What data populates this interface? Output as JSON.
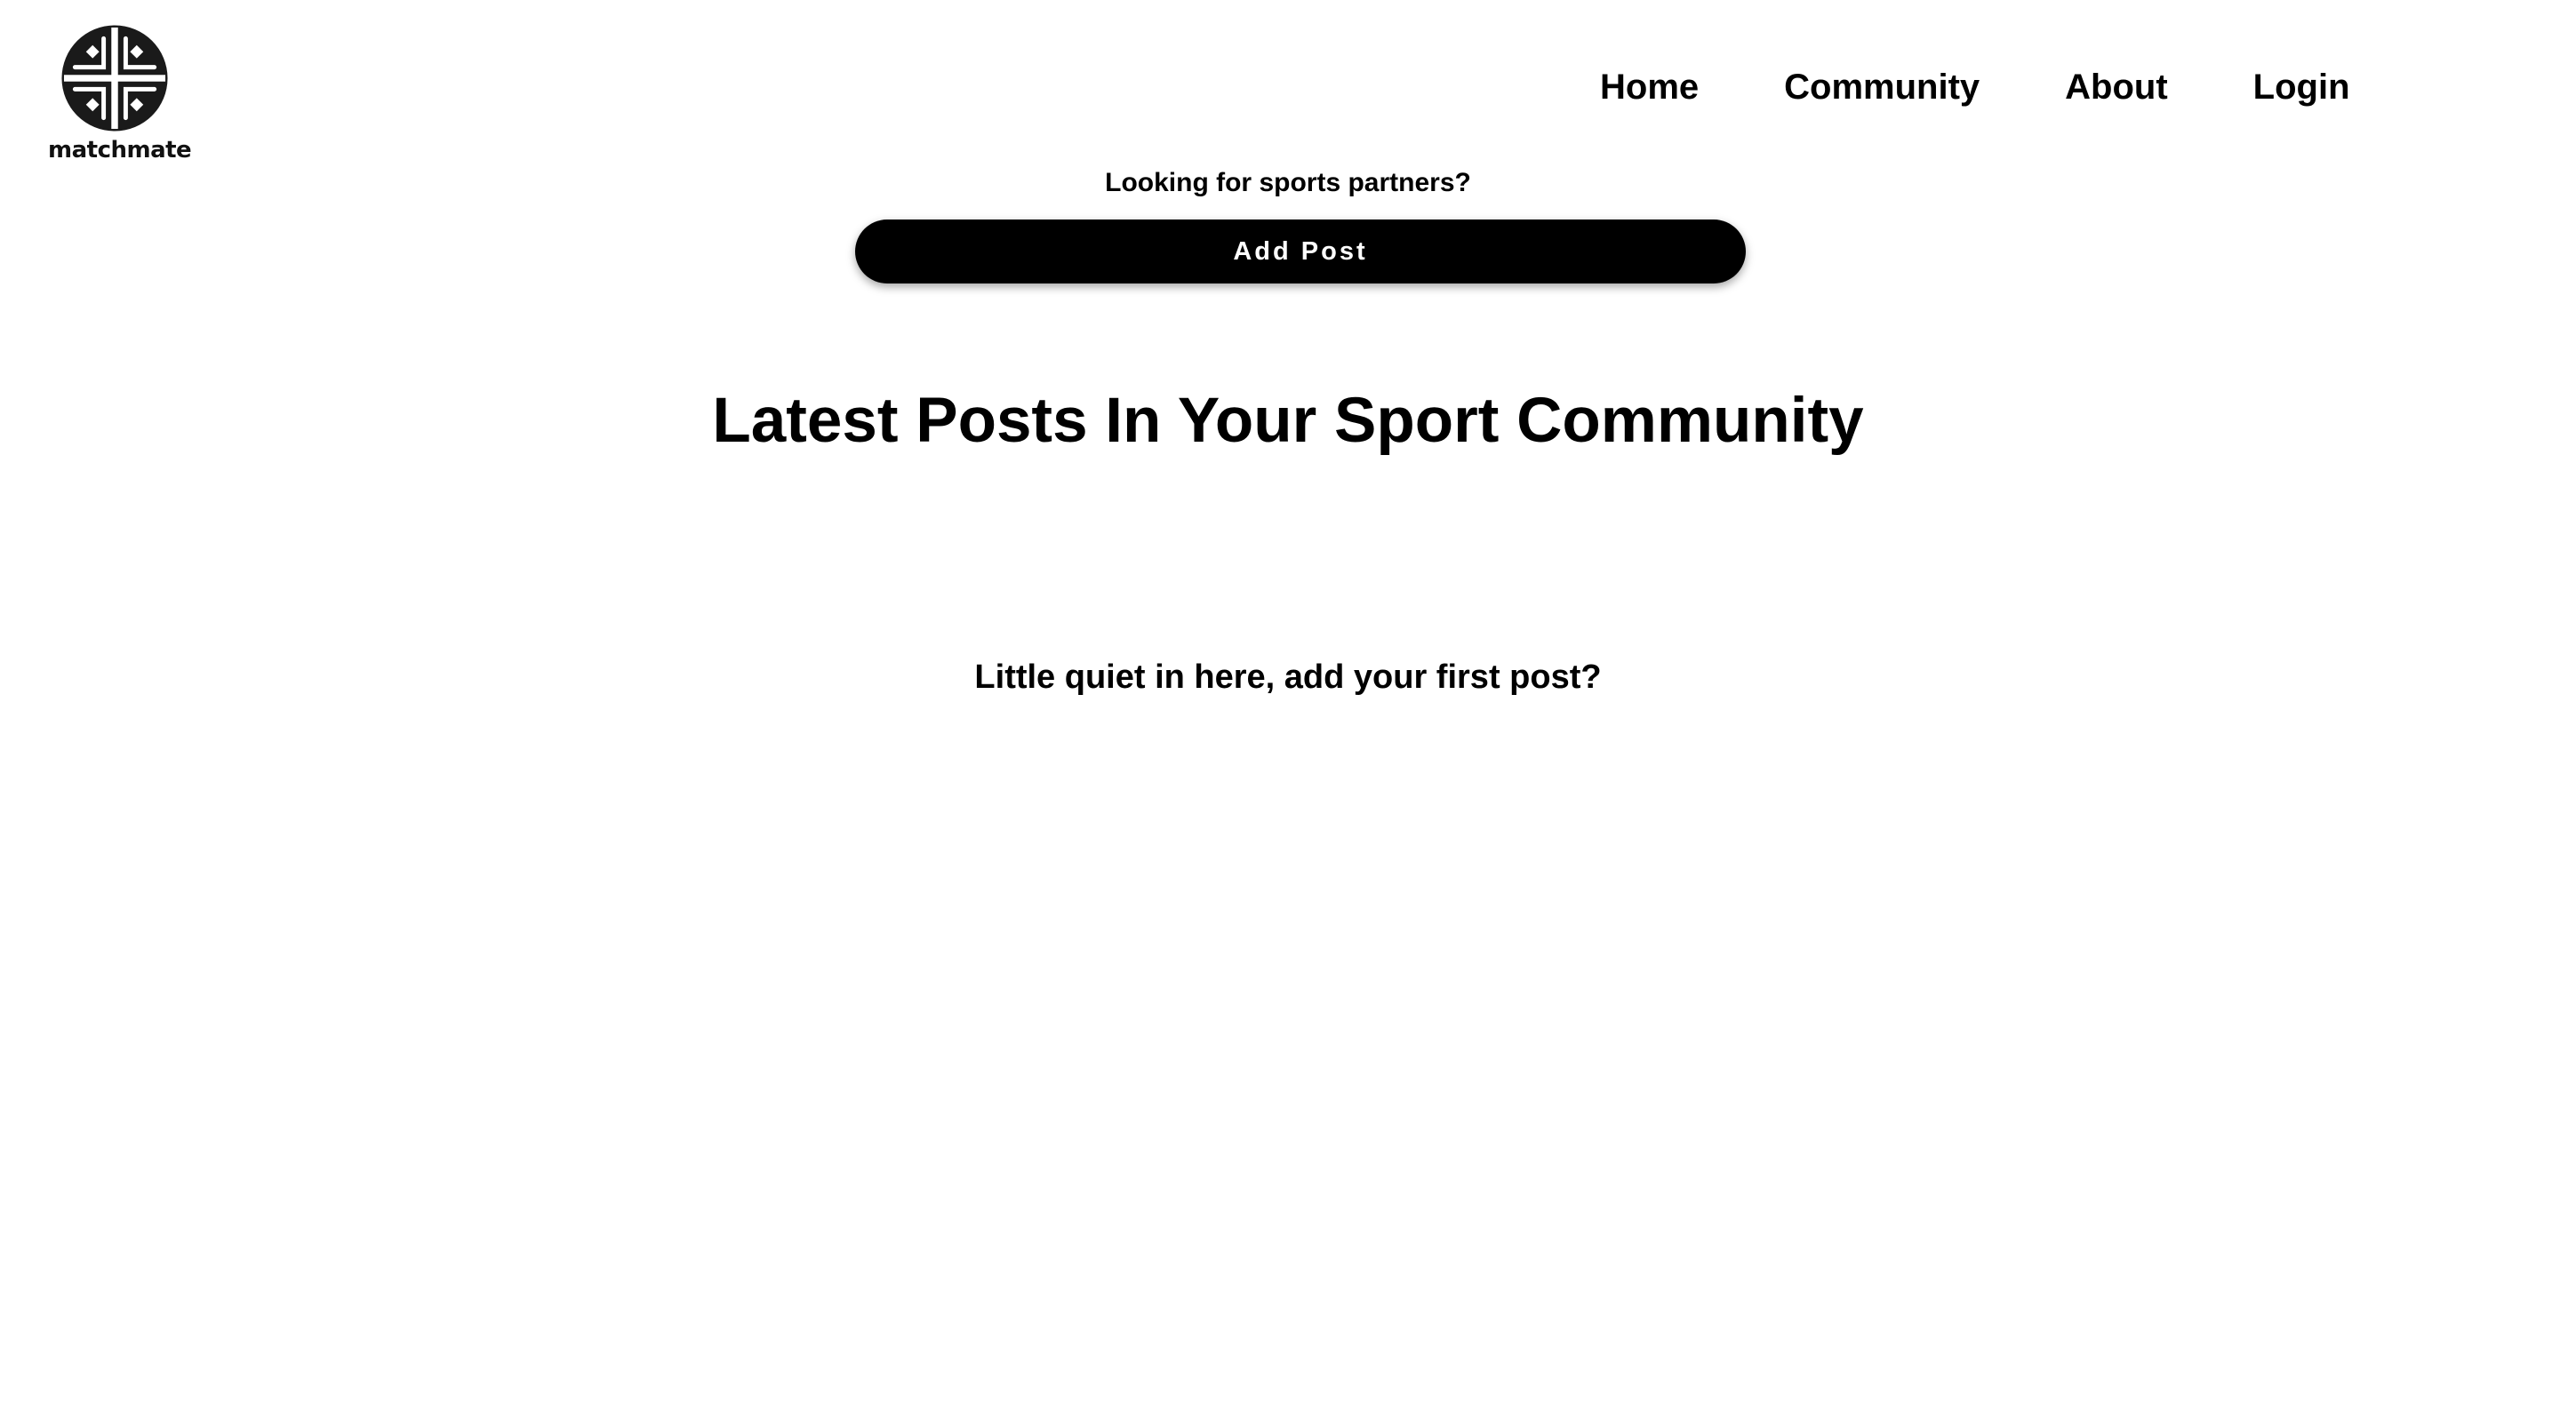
{
  "brand": {
    "name": "matchmate",
    "logo_icon": "sport-ball-emblem-icon",
    "color": "#1a1a1a"
  },
  "nav": {
    "items": [
      {
        "label": "Home"
      },
      {
        "label": "Community"
      },
      {
        "label": "About"
      },
      {
        "label": "Login"
      }
    ]
  },
  "main": {
    "prompt": "Looking for sports partners?",
    "add_post_label": "Add Post",
    "heading": "Latest Posts In Your Sport Community",
    "empty_message": "Little quiet in here, add your first post?"
  },
  "colors": {
    "background": "#ffffff",
    "button": "#000000",
    "button_text": "#ffffff"
  }
}
